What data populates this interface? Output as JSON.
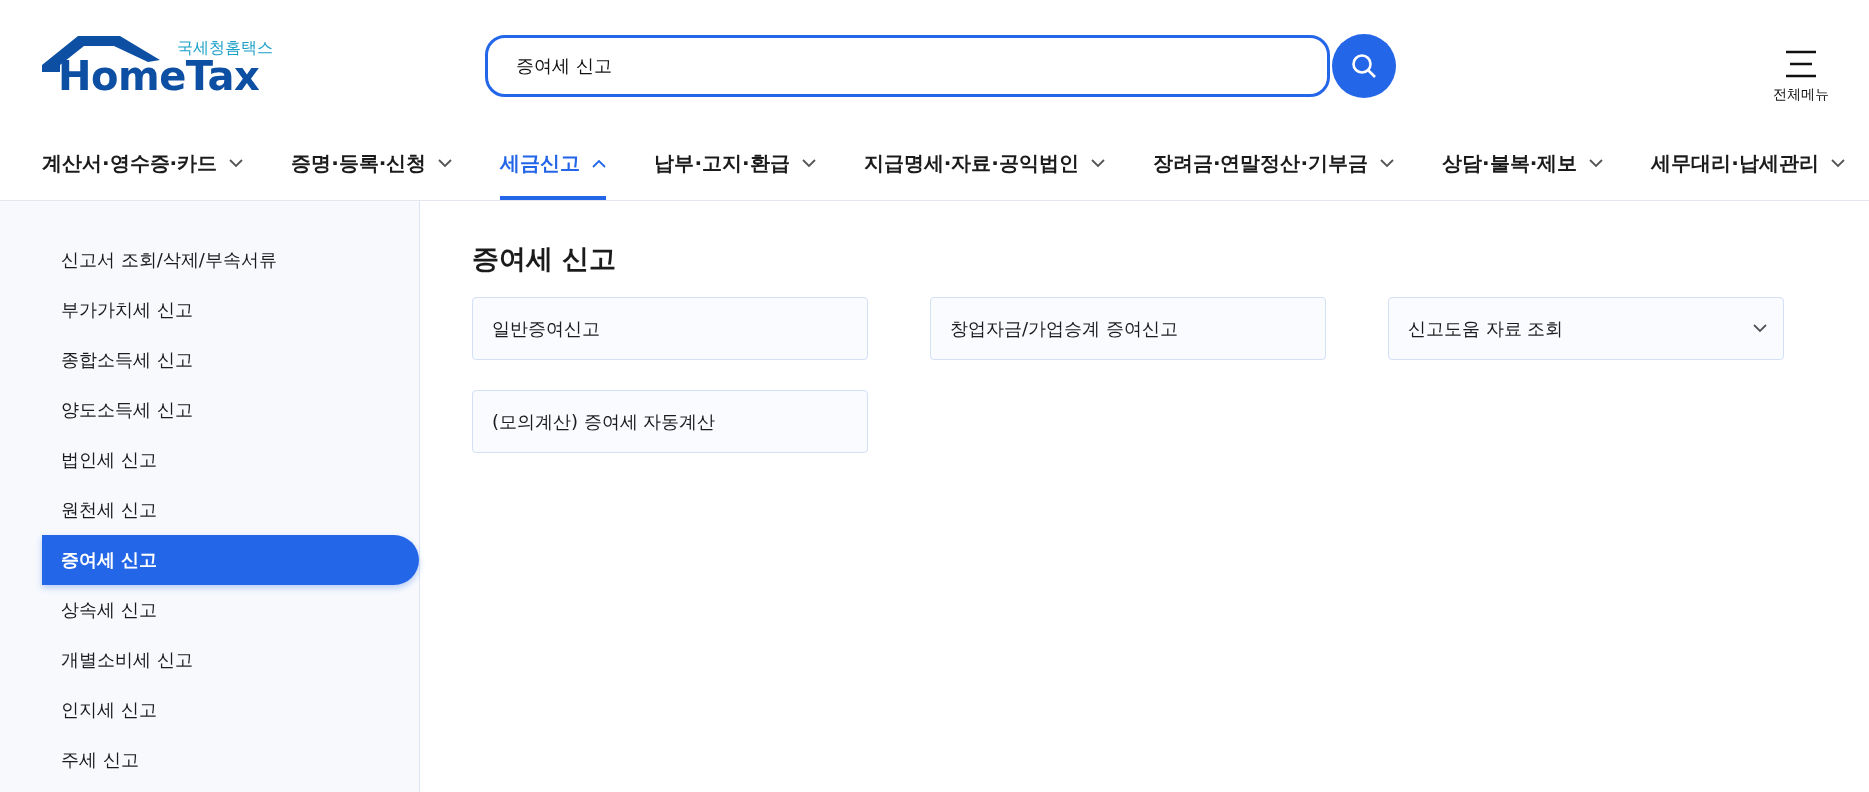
{
  "logo": {
    "caption": "국세청홈택스",
    "wordmark": "HomeTax"
  },
  "search": {
    "value": "증여세 신고"
  },
  "menu_button": {
    "label": "전체메뉴"
  },
  "nav": [
    {
      "label": "계산서·영수증·카드",
      "selected": false,
      "expanded": false
    },
    {
      "label": "증명·등록·신청",
      "selected": false,
      "expanded": false
    },
    {
      "label": "세금신고",
      "selected": true,
      "expanded": true
    },
    {
      "label": "납부·고지·환급",
      "selected": false,
      "expanded": false
    },
    {
      "label": "지급명세·자료·공익법인",
      "selected": false,
      "expanded": false
    },
    {
      "label": "장려금·연말정산·기부금",
      "selected": false,
      "expanded": false
    },
    {
      "label": "상담·불복·제보",
      "selected": false,
      "expanded": false
    },
    {
      "label": "세무대리·납세관리",
      "selected": false,
      "expanded": false
    }
  ],
  "sidebar": {
    "items": [
      {
        "label": "신고서 조회/삭제/부속서류",
        "selected": false
      },
      {
        "label": "부가가치세 신고",
        "selected": false
      },
      {
        "label": "종합소득세 신고",
        "selected": false
      },
      {
        "label": "양도소득세 신고",
        "selected": false
      },
      {
        "label": "법인세 신고",
        "selected": false
      },
      {
        "label": "원천세 신고",
        "selected": false
      },
      {
        "label": "증여세 신고",
        "selected": true
      },
      {
        "label": "상속세 신고",
        "selected": false
      },
      {
        "label": "개별소비세 신고",
        "selected": false
      },
      {
        "label": "인지세 신고",
        "selected": false
      },
      {
        "label": "주세 신고",
        "selected": false
      }
    ]
  },
  "content": {
    "title": "증여세 신고",
    "cards": [
      {
        "label": "일반증여신고",
        "kind": "link"
      },
      {
        "label": "창업자금/가업승계 증여신고",
        "kind": "link"
      },
      {
        "label": "신고도움 자료 조회",
        "kind": "dropdown"
      },
      {
        "label": "(모의계산) 증여세 자동계산",
        "kind": "link"
      }
    ]
  }
}
